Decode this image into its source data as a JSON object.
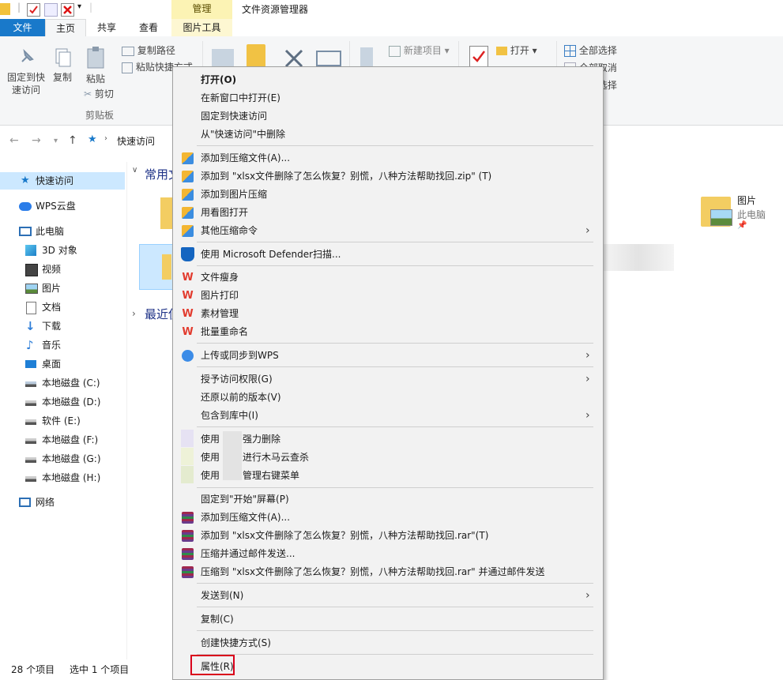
{
  "titlebar": {
    "contextual_tab_header": "管理",
    "window_title": "文件资源管理器"
  },
  "tabs": {
    "file": "文件",
    "home": "主页",
    "share": "共享",
    "view": "查看",
    "picture_tools": "图片工具"
  },
  "ribbon": {
    "pin_quick_access_l1": "固定到快",
    "pin_quick_access_l2": "速访问",
    "copy": "复制",
    "paste": "粘贴",
    "copy_path": "复制路径",
    "paste_shortcut": "粘贴快捷方式",
    "cut": "剪切",
    "clipboard_group": "剪贴板",
    "new_item": "新建项目",
    "open": "打开",
    "select_all": "全部选择",
    "select_none": "全部取消",
    "invert_selection": "反向选择"
  },
  "address": {
    "location": "快速访问"
  },
  "nav": {
    "quick_access": "快速访问",
    "wps_cloud": "WPS云盘",
    "this_pc": "此电脑",
    "objects_3d": "3D 对象",
    "videos": "视频",
    "pictures": "图片",
    "documents": "文档",
    "downloads": "下载",
    "music": "音乐",
    "desktop": "桌面",
    "disk_c": "本地磁盘 (C:)",
    "disk_d": "本地磁盘 (D:)",
    "disk_e": "软件 (E:)",
    "disk_f": "本地磁盘 (F:)",
    "disk_g": "本地磁盘 (G:)",
    "disk_h": "本地磁盘 (H:)",
    "network": "网络"
  },
  "content": {
    "frequent_folders": "常用文",
    "recent_files": "最近使",
    "pictures_tile_name": "图片",
    "pictures_tile_location": "此电脑"
  },
  "status": {
    "item_count": "28 个项目",
    "selected": "选中 1 个项目"
  },
  "menu": {
    "open": "打开(O)",
    "open_new_window": "在新窗口中打开(E)",
    "pin_quick_access": "固定到快速访问",
    "remove_quick_access": "从\"快速访问\"中删除",
    "add_to_archive": "添加到压缩文件(A)...",
    "add_to_zip": "添加到 \"xlsx文件删除了怎么恢复？别慌，八种方法帮助找回.zip\" (T)",
    "add_to_image_compress": "添加到图片压缩",
    "open_with_viewer": "用看图打开",
    "other_compress": "其他压缩命令",
    "defender_scan": "使用 Microsoft Defender扫描...",
    "file_slim": "文件瘦身",
    "picture_print": "图片打印",
    "material_manage": "素材管理",
    "batch_rename": "批量重命名",
    "upload_wps": "上传或同步到WPS",
    "grant_access": "授予访问权限(G)",
    "restore_versions": "还原以前的版本(V)",
    "include_library": "包含到库中(I)",
    "force_delete_pre": "使用",
    "force_delete_post": "强力删除",
    "trojan_scan_pre": "使用",
    "trojan_scan_post": "进行木马云查杀",
    "manage_menu_pre": "使用",
    "manage_menu_post": "管理右键菜单",
    "pin_start": "固定到\"开始\"屏幕(P)",
    "add_to_archive2": "添加到压缩文件(A)...",
    "add_to_rar": "添加到 \"xlsx文件删除了怎么恢复？别慌，八种方法帮助找回.rar\"(T)",
    "compress_email": "压缩并通过邮件发送...",
    "compress_rar_email": "压缩到 \"xlsx文件删除了怎么恢复？别慌，八种方法帮助找回.rar\" 并通过邮件发送",
    "send_to": "发送到(N)",
    "copy": "复制(C)",
    "create_shortcut": "创建快捷方式(S)",
    "properties": "属性(R)"
  },
  "colors": {
    "accent": "#1979ca",
    "selection": "#cce8ff",
    "highlight_box": "#d9001b",
    "context_tab": "#fcf3b4"
  }
}
